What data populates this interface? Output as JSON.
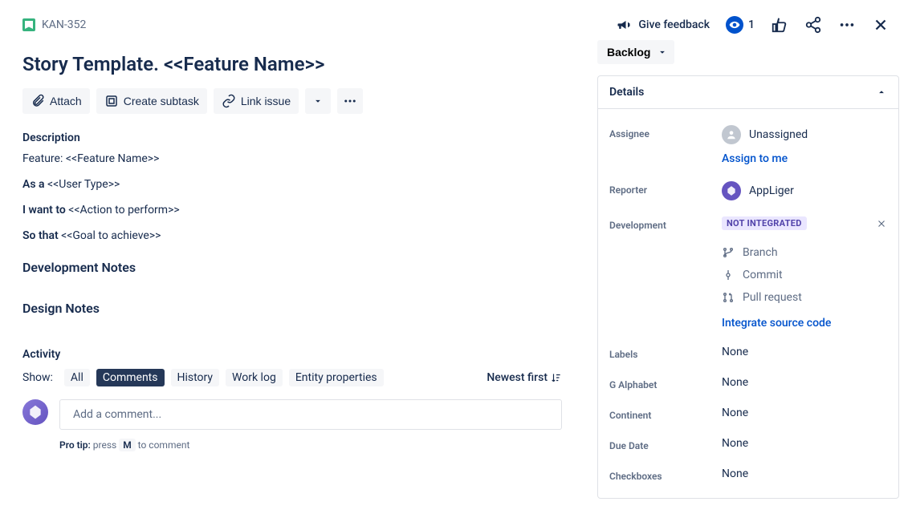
{
  "header": {
    "issue_key": "KAN-352",
    "feedback_label": "Give feedback",
    "watch_count": "1"
  },
  "title": "Story Template. <<Feature Name>>",
  "toolbar": {
    "attach": "Attach",
    "create_subtask": "Create subtask",
    "link_issue": "Link issue"
  },
  "description": {
    "label": "Description",
    "feature_line": "Feature: <<Feature Name>>",
    "as_a_label": "As a",
    "as_a_value": " <<User Type>>",
    "i_want_label": "I want to",
    "i_want_value": " <<Action to perform>>",
    "so_that_label": "So that",
    "so_that_value": " <<Goal to achieve>>",
    "dev_notes_heading": "Development Notes",
    "design_notes_heading": "Design Notes"
  },
  "activity": {
    "label": "Activity",
    "show_label": "Show:",
    "tabs": {
      "all": "All",
      "comments": "Comments",
      "history": "History",
      "worklog": "Work log",
      "entity": "Entity properties"
    },
    "sort": "Newest first",
    "comment_placeholder": "Add a comment...",
    "protip_label": "Pro tip:",
    "protip_press": " press ",
    "protip_key": "M",
    "protip_rest": " to comment"
  },
  "status": {
    "value": "Backlog"
  },
  "details": {
    "header": "Details",
    "assignee": {
      "label": "Assignee",
      "value": "Unassigned",
      "assign_link": "Assign to me"
    },
    "reporter": {
      "label": "Reporter",
      "value": "AppLiger"
    },
    "development": {
      "label": "Development",
      "badge": "NOT INTEGRATED",
      "branch": "Branch",
      "commit": "Commit",
      "pull_request": "Pull request",
      "integrate_link": "Integrate source code"
    },
    "labels": {
      "label": "Labels",
      "value": "None"
    },
    "g_alphabet": {
      "label": "G Alphabet",
      "value": "None"
    },
    "continent": {
      "label": "Continent",
      "value": "None"
    },
    "due_date": {
      "label": "Due Date",
      "value": "None"
    },
    "checkboxes": {
      "label": "Checkboxes",
      "value": "None"
    }
  }
}
